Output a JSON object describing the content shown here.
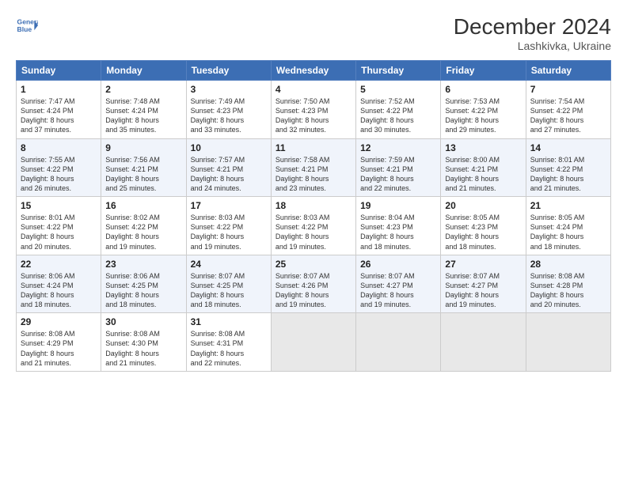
{
  "header": {
    "logo_line1": "General",
    "logo_line2": "Blue",
    "title": "December 2024",
    "subtitle": "Lashkivka, Ukraine"
  },
  "days_of_week": [
    "Sunday",
    "Monday",
    "Tuesday",
    "Wednesday",
    "Thursday",
    "Friday",
    "Saturday"
  ],
  "weeks": [
    [
      {
        "day": "1",
        "info": "Sunrise: 7:47 AM\nSunset: 4:24 PM\nDaylight: 8 hours\nand 37 minutes."
      },
      {
        "day": "2",
        "info": "Sunrise: 7:48 AM\nSunset: 4:24 PM\nDaylight: 8 hours\nand 35 minutes."
      },
      {
        "day": "3",
        "info": "Sunrise: 7:49 AM\nSunset: 4:23 PM\nDaylight: 8 hours\nand 33 minutes."
      },
      {
        "day": "4",
        "info": "Sunrise: 7:50 AM\nSunset: 4:23 PM\nDaylight: 8 hours\nand 32 minutes."
      },
      {
        "day": "5",
        "info": "Sunrise: 7:52 AM\nSunset: 4:22 PM\nDaylight: 8 hours\nand 30 minutes."
      },
      {
        "day": "6",
        "info": "Sunrise: 7:53 AM\nSunset: 4:22 PM\nDaylight: 8 hours\nand 29 minutes."
      },
      {
        "day": "7",
        "info": "Sunrise: 7:54 AM\nSunset: 4:22 PM\nDaylight: 8 hours\nand 27 minutes."
      }
    ],
    [
      {
        "day": "8",
        "info": "Sunrise: 7:55 AM\nSunset: 4:22 PM\nDaylight: 8 hours\nand 26 minutes."
      },
      {
        "day": "9",
        "info": "Sunrise: 7:56 AM\nSunset: 4:21 PM\nDaylight: 8 hours\nand 25 minutes."
      },
      {
        "day": "10",
        "info": "Sunrise: 7:57 AM\nSunset: 4:21 PM\nDaylight: 8 hours\nand 24 minutes."
      },
      {
        "day": "11",
        "info": "Sunrise: 7:58 AM\nSunset: 4:21 PM\nDaylight: 8 hours\nand 23 minutes."
      },
      {
        "day": "12",
        "info": "Sunrise: 7:59 AM\nSunset: 4:21 PM\nDaylight: 8 hours\nand 22 minutes."
      },
      {
        "day": "13",
        "info": "Sunrise: 8:00 AM\nSunset: 4:21 PM\nDaylight: 8 hours\nand 21 minutes."
      },
      {
        "day": "14",
        "info": "Sunrise: 8:01 AM\nSunset: 4:22 PM\nDaylight: 8 hours\nand 21 minutes."
      }
    ],
    [
      {
        "day": "15",
        "info": "Sunrise: 8:01 AM\nSunset: 4:22 PM\nDaylight: 8 hours\nand 20 minutes."
      },
      {
        "day": "16",
        "info": "Sunrise: 8:02 AM\nSunset: 4:22 PM\nDaylight: 8 hours\nand 19 minutes."
      },
      {
        "day": "17",
        "info": "Sunrise: 8:03 AM\nSunset: 4:22 PM\nDaylight: 8 hours\nand 19 minutes."
      },
      {
        "day": "18",
        "info": "Sunrise: 8:03 AM\nSunset: 4:22 PM\nDaylight: 8 hours\nand 19 minutes."
      },
      {
        "day": "19",
        "info": "Sunrise: 8:04 AM\nSunset: 4:23 PM\nDaylight: 8 hours\nand 18 minutes."
      },
      {
        "day": "20",
        "info": "Sunrise: 8:05 AM\nSunset: 4:23 PM\nDaylight: 8 hours\nand 18 minutes."
      },
      {
        "day": "21",
        "info": "Sunrise: 8:05 AM\nSunset: 4:24 PM\nDaylight: 8 hours\nand 18 minutes."
      }
    ],
    [
      {
        "day": "22",
        "info": "Sunrise: 8:06 AM\nSunset: 4:24 PM\nDaylight: 8 hours\nand 18 minutes."
      },
      {
        "day": "23",
        "info": "Sunrise: 8:06 AM\nSunset: 4:25 PM\nDaylight: 8 hours\nand 18 minutes."
      },
      {
        "day": "24",
        "info": "Sunrise: 8:07 AM\nSunset: 4:25 PM\nDaylight: 8 hours\nand 18 minutes."
      },
      {
        "day": "25",
        "info": "Sunrise: 8:07 AM\nSunset: 4:26 PM\nDaylight: 8 hours\nand 19 minutes."
      },
      {
        "day": "26",
        "info": "Sunrise: 8:07 AM\nSunset: 4:27 PM\nDaylight: 8 hours\nand 19 minutes."
      },
      {
        "day": "27",
        "info": "Sunrise: 8:07 AM\nSunset: 4:27 PM\nDaylight: 8 hours\nand 19 minutes."
      },
      {
        "day": "28",
        "info": "Sunrise: 8:08 AM\nSunset: 4:28 PM\nDaylight: 8 hours\nand 20 minutes."
      }
    ],
    [
      {
        "day": "29",
        "info": "Sunrise: 8:08 AM\nSunset: 4:29 PM\nDaylight: 8 hours\nand 21 minutes."
      },
      {
        "day": "30",
        "info": "Sunrise: 8:08 AM\nSunset: 4:30 PM\nDaylight: 8 hours\nand 21 minutes."
      },
      {
        "day": "31",
        "info": "Sunrise: 8:08 AM\nSunset: 4:31 PM\nDaylight: 8 hours\nand 22 minutes."
      },
      {
        "day": "",
        "info": ""
      },
      {
        "day": "",
        "info": ""
      },
      {
        "day": "",
        "info": ""
      },
      {
        "day": "",
        "info": ""
      }
    ]
  ]
}
